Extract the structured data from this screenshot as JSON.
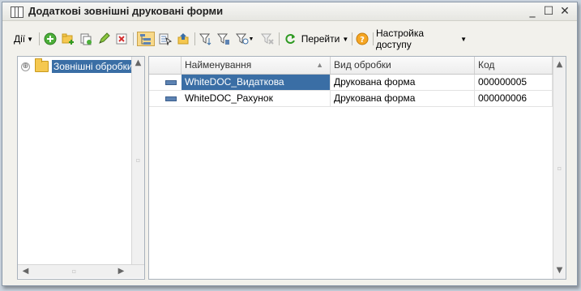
{
  "window": {
    "title": "Додаткові зовнішні друковані форми",
    "minimize_glyph": "_",
    "maximize_glyph": "☐",
    "close_glyph": "✕"
  },
  "toolbar": {
    "actions_label": "Дії",
    "goto_label": "Перейти",
    "access_label": "Настройка доступу",
    "icons": [
      "add-icon",
      "add-group-icon",
      "copy-icon",
      "edit-icon",
      "delete-icon",
      "tree-view-icon",
      "hierarchy-icon",
      "level-up-icon",
      "filter-icon",
      "filter-by-value-icon",
      "filter-history-icon",
      "clear-filter-icon",
      "refresh-icon",
      "help-icon"
    ]
  },
  "tree": {
    "expander": "⊕",
    "root_label": "Зовнішні обробки"
  },
  "table": {
    "columns": [
      "Найменування",
      "Вид обробки",
      "Код"
    ],
    "rows": [
      {
        "name": "WhiteDOC_Видаткова",
        "type": "Друкована форма",
        "code": "000000005",
        "selected": true
      },
      {
        "name": "WhiteDOC_Рахунок",
        "type": "Друкована форма",
        "code": "000000006",
        "selected": false
      }
    ]
  },
  "colors": {
    "selection": "#3a6ea5",
    "window_bg": "#f2f1ec"
  }
}
